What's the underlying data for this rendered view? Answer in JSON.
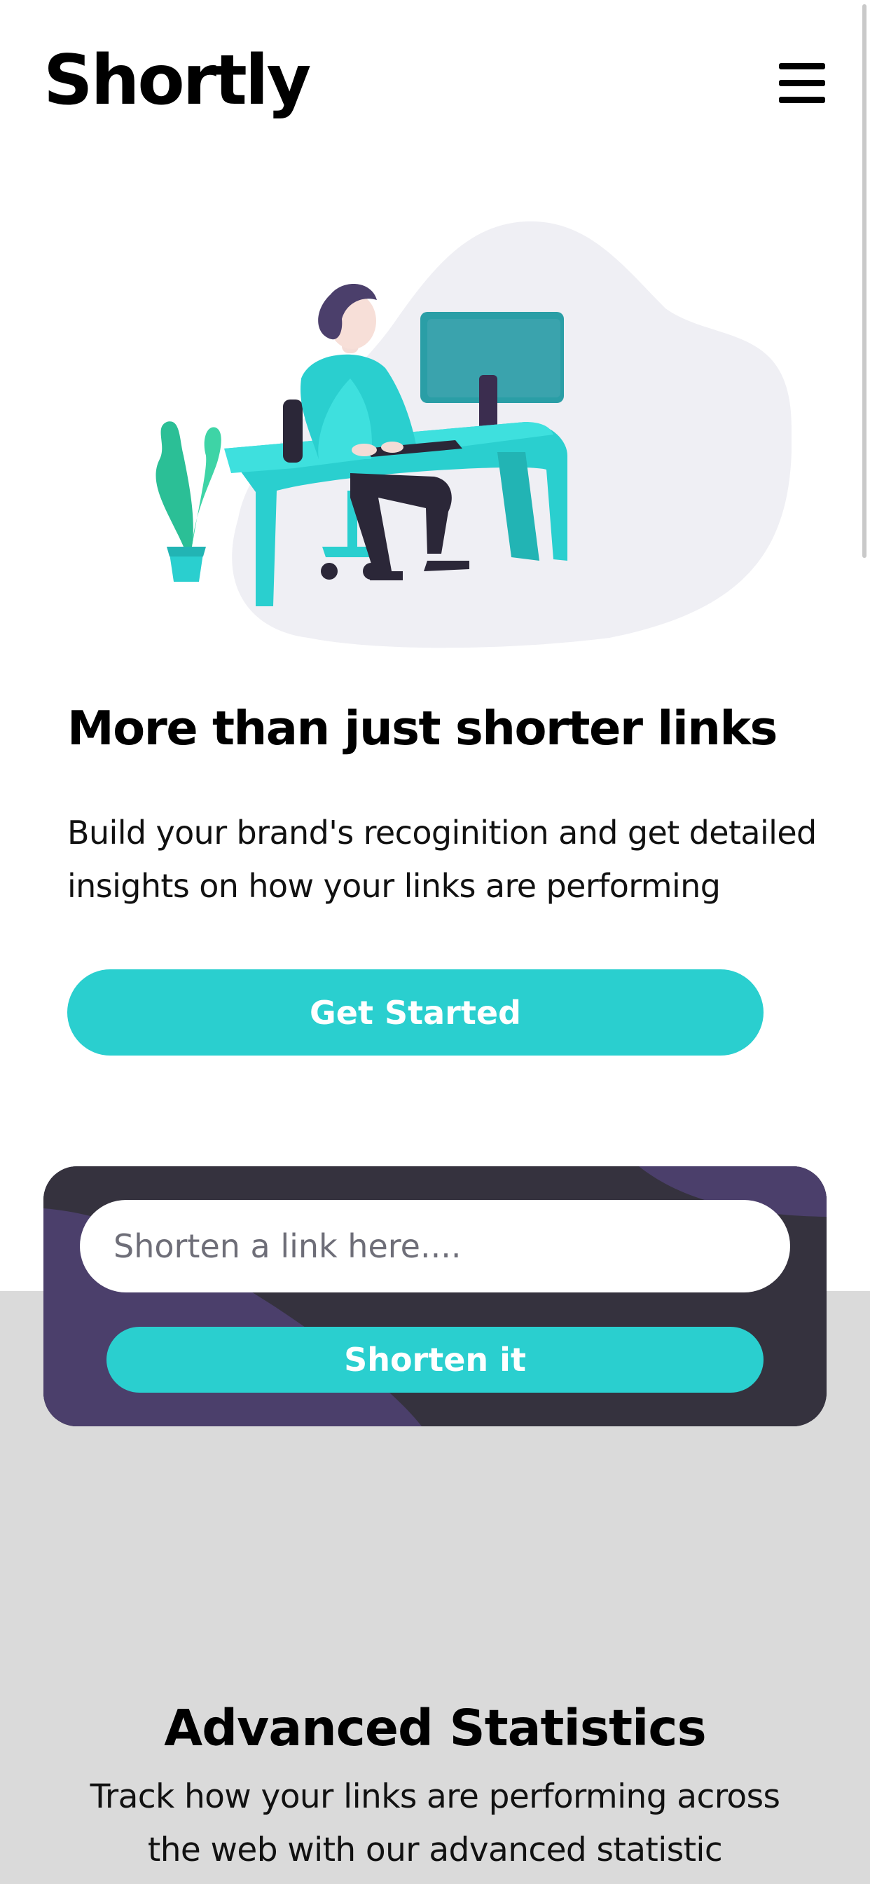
{
  "header": {
    "logo": "Shortly",
    "menu_icon": "hamburger-menu-icon"
  },
  "hero": {
    "illustration": "person-working-at-desk-illustration",
    "title": "More than just shorter links",
    "description": "Build your brand's recoginition and get detailed insights on how your links are performing",
    "cta_label": "Get Started"
  },
  "shorten": {
    "placeholder": "Shorten a link here....",
    "value": "",
    "button_label": "Shorten it"
  },
  "stats": {
    "title": "Advanced Statistics",
    "description": "Track how your links are performing across the web with our advanced statistic"
  },
  "colors": {
    "cyan": "#2acfcf",
    "dark_violet": "#35323e",
    "violet": "#4b3f6b",
    "band_gray": "#dadada"
  }
}
